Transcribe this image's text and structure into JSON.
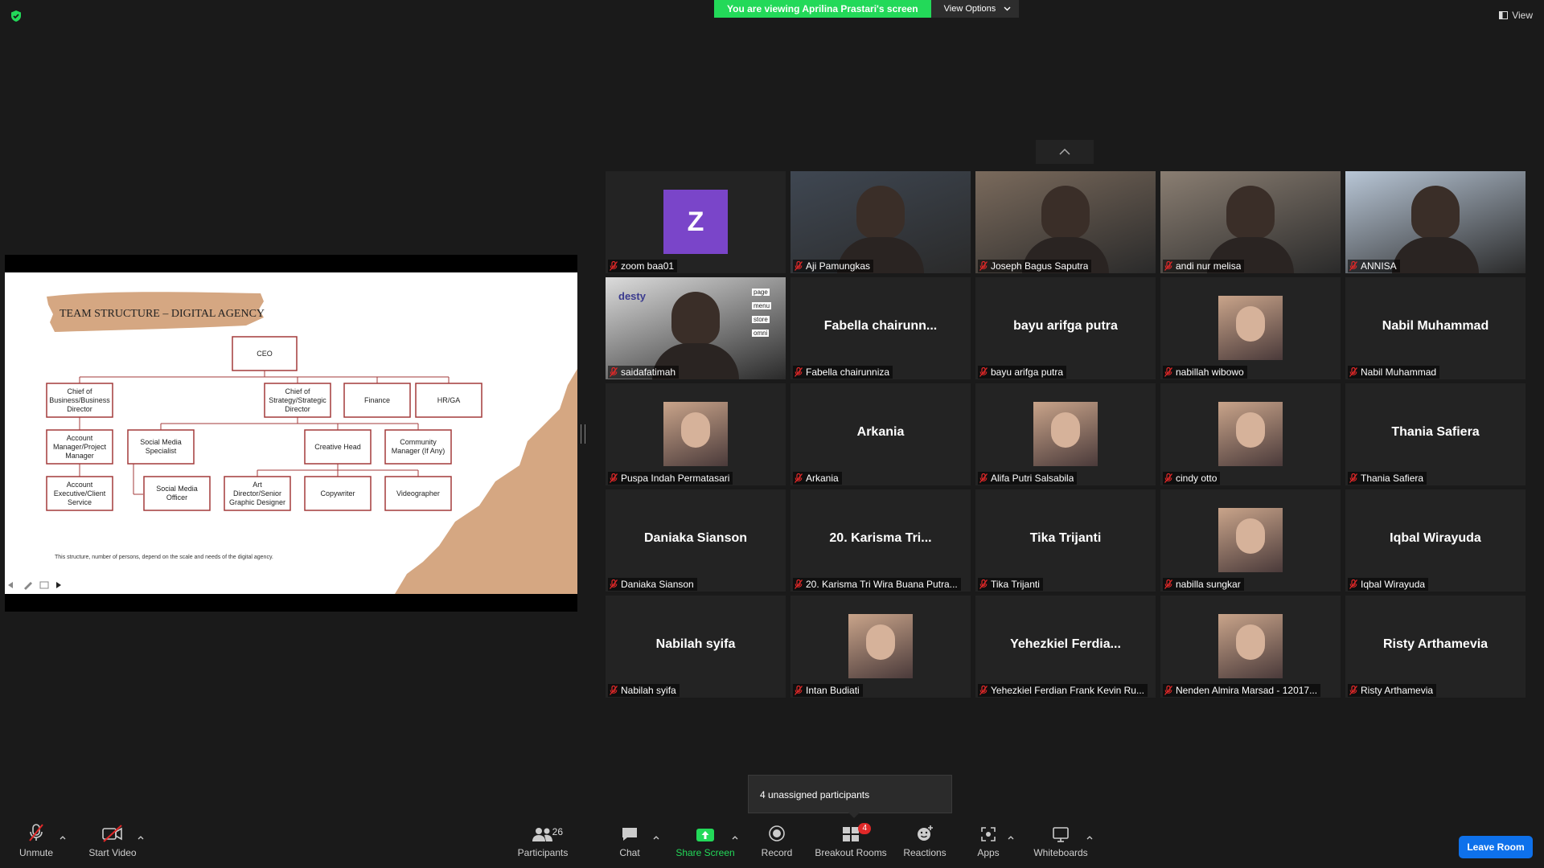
{
  "banner": {
    "message": "You are viewing Aprilina Prastari's screen",
    "view_options": "View Options"
  },
  "view_label": "View",
  "slide": {
    "title": "TEAM STRUCTURE – DIGITAL  AGENCY",
    "boxes": {
      "ceo": "CEO",
      "cbd": [
        "Chief of",
        "Business/Business",
        "Director"
      ],
      "csd": [
        "Chief of",
        "Strategy/Strategic",
        "Director"
      ],
      "finance": "Finance",
      "hrga": "HR/GA",
      "am": [
        "Account",
        "Manager/Project",
        "Manager"
      ],
      "sms": [
        "Social Media",
        "Specialist"
      ],
      "ch": "Creative Head",
      "cm": [
        "Community",
        "Manager (If Any)"
      ],
      "ae": [
        "Account",
        "Executive/Client",
        "Service"
      ],
      "smo": [
        "Social Media",
        "Officer"
      ],
      "ad": [
        "Art",
        "Director/Senior",
        "Graphic Designer"
      ],
      "cw": "Copywriter",
      "vg": "Videographer"
    },
    "footnote": "This structure, number of persons, depend on the scale and needs of the digital agency."
  },
  "participants": [
    {
      "label": "zoom baa01",
      "avatar": "Z",
      "avatar_color": "#7a45c9"
    },
    {
      "label": "Aji Pamungkas",
      "video": true
    },
    {
      "label": "Joseph Bagus Saputra",
      "video": true
    },
    {
      "label": "andi nur melisa",
      "video": true
    },
    {
      "label": "ANNISA",
      "video": true
    },
    {
      "label": "saidafatimah",
      "video": true
    },
    {
      "label": "Fabella chairunniza",
      "display": "Fabella  chairunn..."
    },
    {
      "label": "bayu arifga putra",
      "display": "bayu arifga putra"
    },
    {
      "label": "nabillah wibowo",
      "photo": true
    },
    {
      "label": "Nabil Muhammad",
      "display": "Nabil Muhammad"
    },
    {
      "label": "Puspa Indah Permatasari",
      "photo": true
    },
    {
      "label": "Arkania",
      "display": "Arkania"
    },
    {
      "label": "Alifa Putri Salsabila",
      "photo": true
    },
    {
      "label": "cindy otto",
      "photo": true
    },
    {
      "label": "Thania Safiera",
      "display": "Thania Safiera"
    },
    {
      "label": "Daniaka Sianson",
      "display": "Daniaka Sianson"
    },
    {
      "label": "20. Karisma Tri Wira Buana Putra...",
      "display": "20. Karisma Tri..."
    },
    {
      "label": "Tika Trijanti",
      "display": "Tika Trijanti"
    },
    {
      "label": "nabilla sungkar",
      "photo": true
    },
    {
      "label": "Iqbal Wirayuda",
      "display": "Iqbal Wirayuda"
    },
    {
      "label": "Nabilah syifa",
      "display": "Nabilah syifa"
    },
    {
      "label": "Intan Budiati",
      "photo": true
    },
    {
      "label": "Yehezkiel Ferdian Frank Kevin Ru...",
      "display": "Yehezkiel  Ferdia..."
    },
    {
      "label": "Nenden Almira Marsad - 12017...",
      "photo": true
    },
    {
      "label": "Risty Arthamevia",
      "display": "Risty Arthamevia"
    }
  ],
  "desty_tile": {
    "brand": "desty",
    "apps": [
      "page",
      "menu",
      "store",
      "omni"
    ]
  },
  "tooltip": "4 unassigned participants",
  "toolbar": {
    "unmute": "Unmute",
    "start_video": "Start Video",
    "participants": "Participants",
    "participants_count": "26",
    "chat": "Chat",
    "share_screen": "Share Screen",
    "record": "Record",
    "breakout_rooms": "Breakout Rooms",
    "breakout_badge": "4",
    "reactions": "Reactions",
    "apps": "Apps",
    "whiteboards": "Whiteboards",
    "leave": "Leave Room"
  },
  "colors": {
    "banner_green": "#23d959",
    "leave_blue": "#0e71eb",
    "mute_red": "#e02828",
    "slide_box": "#a33a3a",
    "slide_tan": "#d5a782"
  }
}
